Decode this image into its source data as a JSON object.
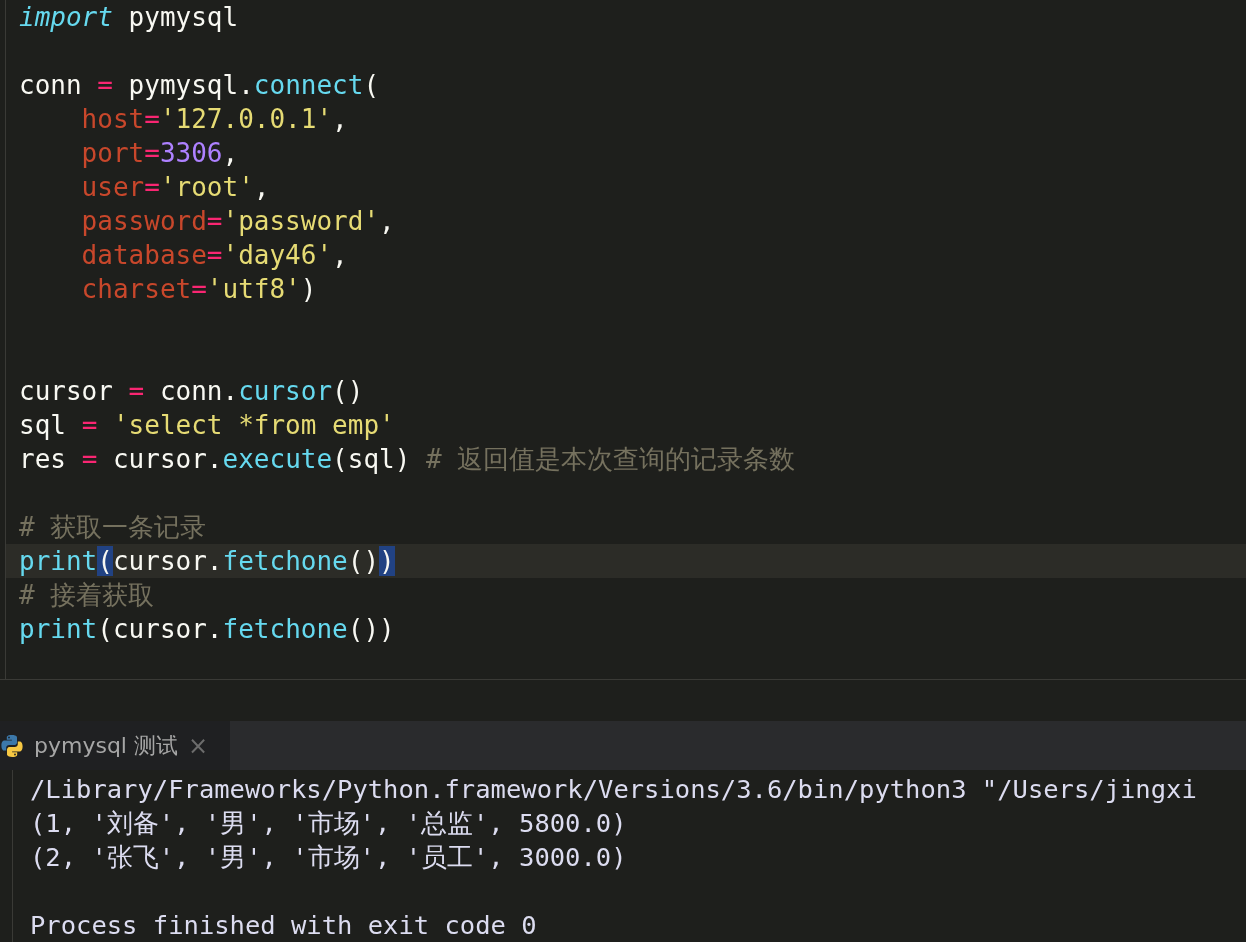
{
  "editor": {
    "lines": [
      {
        "kind": "code",
        "current": false,
        "tokens": [
          {
            "kind": "keyword",
            "text": "import"
          },
          {
            "kind": "plain",
            "text": " pymysql"
          }
        ]
      },
      {
        "kind": "blank",
        "current": false
      },
      {
        "kind": "code",
        "current": false,
        "tokens": [
          {
            "kind": "plain",
            "text": "conn "
          },
          {
            "kind": "operator",
            "text": "="
          },
          {
            "kind": "plain",
            "text": " pymysql."
          },
          {
            "kind": "function",
            "text": "connect"
          },
          {
            "kind": "plain",
            "text": "("
          }
        ]
      },
      {
        "kind": "code",
        "indent": true,
        "current": false,
        "tokens": [
          {
            "kind": "param",
            "text": "host"
          },
          {
            "kind": "operator",
            "text": "="
          },
          {
            "kind": "string",
            "text": "'127.0.0.1'"
          },
          {
            "kind": "plain",
            "text": ","
          }
        ]
      },
      {
        "kind": "code",
        "indent": true,
        "current": false,
        "tokens": [
          {
            "kind": "param",
            "text": "port"
          },
          {
            "kind": "operator",
            "text": "="
          },
          {
            "kind": "number",
            "text": "3306"
          },
          {
            "kind": "plain",
            "text": ","
          }
        ]
      },
      {
        "kind": "code",
        "indent": true,
        "current": false,
        "tokens": [
          {
            "kind": "param",
            "text": "user"
          },
          {
            "kind": "operator",
            "text": "="
          },
          {
            "kind": "string",
            "text": "'root'"
          },
          {
            "kind": "plain",
            "text": ","
          }
        ]
      },
      {
        "kind": "code",
        "indent": true,
        "current": false,
        "tokens": [
          {
            "kind": "param",
            "text": "password"
          },
          {
            "kind": "operator",
            "text": "="
          },
          {
            "kind": "string",
            "text": "'password'"
          },
          {
            "kind": "plain",
            "text": ","
          }
        ]
      },
      {
        "kind": "code",
        "indent": true,
        "current": false,
        "tokens": [
          {
            "kind": "param",
            "text": "database"
          },
          {
            "kind": "operator",
            "text": "="
          },
          {
            "kind": "string",
            "text": "'day46'"
          },
          {
            "kind": "plain",
            "text": ","
          }
        ]
      },
      {
        "kind": "code",
        "indent": true,
        "current": false,
        "tokens": [
          {
            "kind": "param",
            "text": "charset"
          },
          {
            "kind": "operator",
            "text": "="
          },
          {
            "kind": "string",
            "text": "'utf8'"
          },
          {
            "kind": "plain",
            "text": ")"
          }
        ]
      },
      {
        "kind": "blank",
        "current": false
      },
      {
        "kind": "blank",
        "current": false
      },
      {
        "kind": "code",
        "current": false,
        "tokens": [
          {
            "kind": "plain",
            "text": "cursor "
          },
          {
            "kind": "operator",
            "text": "="
          },
          {
            "kind": "plain",
            "text": " conn."
          },
          {
            "kind": "function",
            "text": "cursor"
          },
          {
            "kind": "plain",
            "text": "()"
          }
        ]
      },
      {
        "kind": "code",
        "current": false,
        "tokens": [
          {
            "kind": "plain",
            "text": "sql "
          },
          {
            "kind": "operator",
            "text": "= "
          },
          {
            "kind": "string",
            "text": "'select *from emp'"
          }
        ]
      },
      {
        "kind": "code",
        "current": false,
        "tokens": [
          {
            "kind": "plain",
            "text": "res "
          },
          {
            "kind": "operator",
            "text": "="
          },
          {
            "kind": "plain",
            "text": " cursor."
          },
          {
            "kind": "function",
            "text": "execute"
          },
          {
            "kind": "plain",
            "text": "(sql) "
          },
          {
            "kind": "comment",
            "text": "# 返回值是本次查询的记录条数"
          }
        ]
      },
      {
        "kind": "blank",
        "current": false
      },
      {
        "kind": "code",
        "current": false,
        "tokens": [
          {
            "kind": "comment",
            "text": "# 获取一条记录"
          }
        ]
      },
      {
        "kind": "code",
        "current": true,
        "tokens": [
          {
            "kind": "function",
            "text": "print"
          },
          {
            "kind": "bracket_match",
            "text": "("
          },
          {
            "kind": "plain",
            "text": "cursor."
          },
          {
            "kind": "function",
            "text": "fetchone"
          },
          {
            "kind": "plain",
            "text": "()"
          },
          {
            "kind": "bracket_match",
            "text": ")"
          }
        ]
      },
      {
        "kind": "code",
        "current": false,
        "tokens": [
          {
            "kind": "comment",
            "text": "# 接着获取"
          }
        ]
      },
      {
        "kind": "code",
        "current": false,
        "tokens": [
          {
            "kind": "function",
            "text": "print"
          },
          {
            "kind": "plain",
            "text": "(cursor."
          },
          {
            "kind": "function",
            "text": "fetchone"
          },
          {
            "kind": "plain",
            "text": "())"
          }
        ]
      },
      {
        "kind": "blank",
        "current": false
      }
    ]
  },
  "run_panel": {
    "tabs": [
      {
        "label": "pymysql 测试",
        "close": "×",
        "selected": true
      }
    ],
    "output": [
      {
        "kind": "text",
        "text": "/Library/Frameworks/Python.framework/Versions/3.6/bin/python3 \"/Users/jingxi"
      },
      {
        "kind": "text",
        "text": "(1, '刘备', '男', '市场', '总监', 5800.0)"
      },
      {
        "kind": "text",
        "text": "(2, '张飞', '男', '市场', '员工', 3000.0)"
      },
      {
        "kind": "blank"
      },
      {
        "kind": "text",
        "text": "Process finished with exit code 0"
      }
    ]
  }
}
